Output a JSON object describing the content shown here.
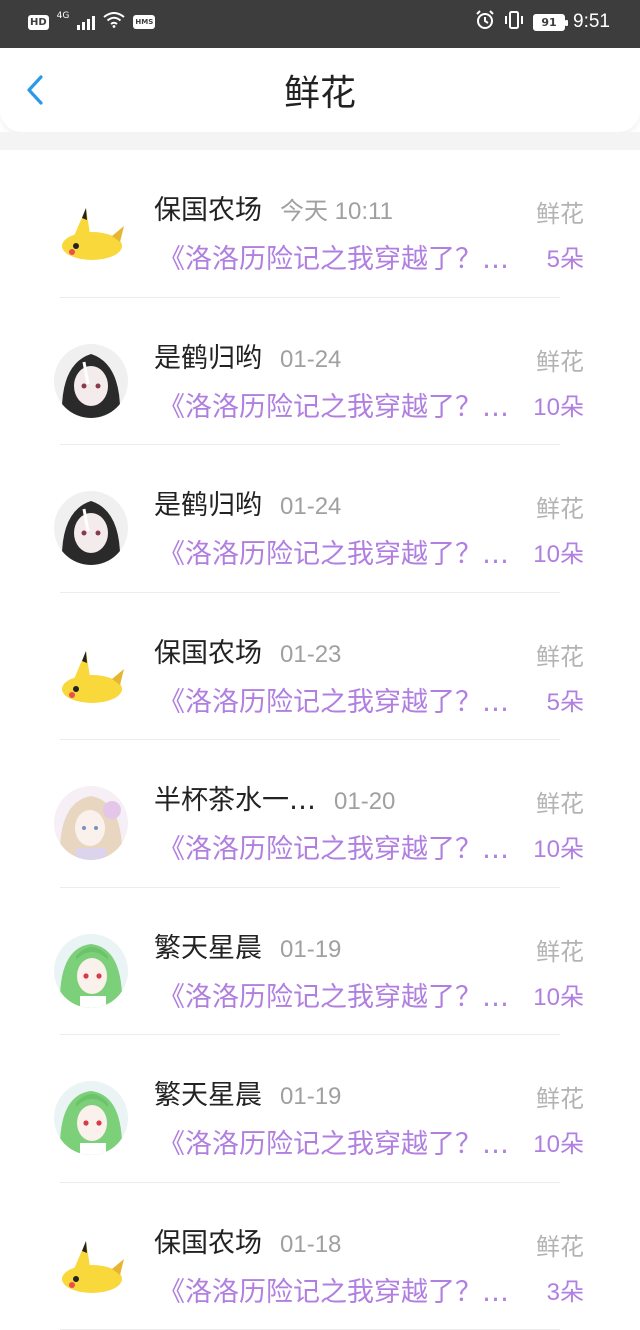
{
  "status_bar": {
    "hd": "HD",
    "network": "4G",
    "hms": "HMS",
    "battery": "91",
    "time": "9:51"
  },
  "header": {
    "title": "鲜花",
    "back_icon": "chevron-left-icon"
  },
  "items": [
    {
      "name": "保国农场",
      "time": "今天 10:11",
      "tag": "鲜花",
      "book": "《洛洛历险记之我穿越了？…",
      "count": "5朵",
      "avatar": "pikachu"
    },
    {
      "name": "是鹤归哟",
      "time": "01-24",
      "tag": "鲜花",
      "book": "《洛洛历险记之我穿越了？…",
      "count": "10朵",
      "avatar": "dark-hair-girl"
    },
    {
      "name": "是鹤归哟",
      "time": "01-24",
      "tag": "鲜花",
      "book": "《洛洛历险记之我穿越了？…",
      "count": "10朵",
      "avatar": "dark-hair-girl"
    },
    {
      "name": "保国农场",
      "time": "01-23",
      "tag": "鲜花",
      "book": "《洛洛历险记之我穿越了？…",
      "count": "5朵",
      "avatar": "pikachu"
    },
    {
      "name": "半杯茶水一…",
      "time": "01-20",
      "tag": "鲜花",
      "book": "《洛洛历险记之我穿越了？…",
      "count": "10朵",
      "avatar": "blonde-girl"
    },
    {
      "name": "繁天星晨",
      "time": "01-19",
      "tag": "鲜花",
      "book": "《洛洛历险记之我穿越了？…",
      "count": "10朵",
      "avatar": "green-hair-girl"
    },
    {
      "name": "繁天星晨",
      "time": "01-19",
      "tag": "鲜花",
      "book": "《洛洛历险记之我穿越了？…",
      "count": "10朵",
      "avatar": "green-hair-girl"
    },
    {
      "name": "保国农场",
      "time": "01-18",
      "tag": "鲜花",
      "book": "《洛洛历险记之我穿越了？…",
      "count": "3朵",
      "avatar": "pikachu"
    }
  ],
  "colors": {
    "status_bar_bg": "#3d3d3d",
    "accent_blue": "#2a9ae8",
    "book_purple": "#b07fe0",
    "muted_gray": "#a0a0a0"
  }
}
